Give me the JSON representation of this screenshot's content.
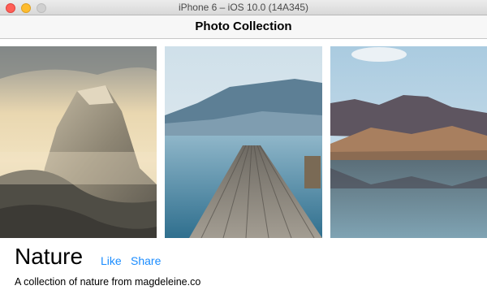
{
  "window": {
    "title": "iPhone 6 – iOS 10.0 (14A345)"
  },
  "nav": {
    "title": "Photo Collection"
  },
  "collection": {
    "title": "Nature",
    "like_label": "Like",
    "share_label": "Share",
    "description": "A collection of nature from magdeleine.co"
  },
  "colors": {
    "accent": "#1a8cff"
  },
  "photos": [
    {
      "subject": "misty mountain peak"
    },
    {
      "subject": "wooden dock over lake"
    },
    {
      "subject": "mountain lake reflection"
    }
  ]
}
